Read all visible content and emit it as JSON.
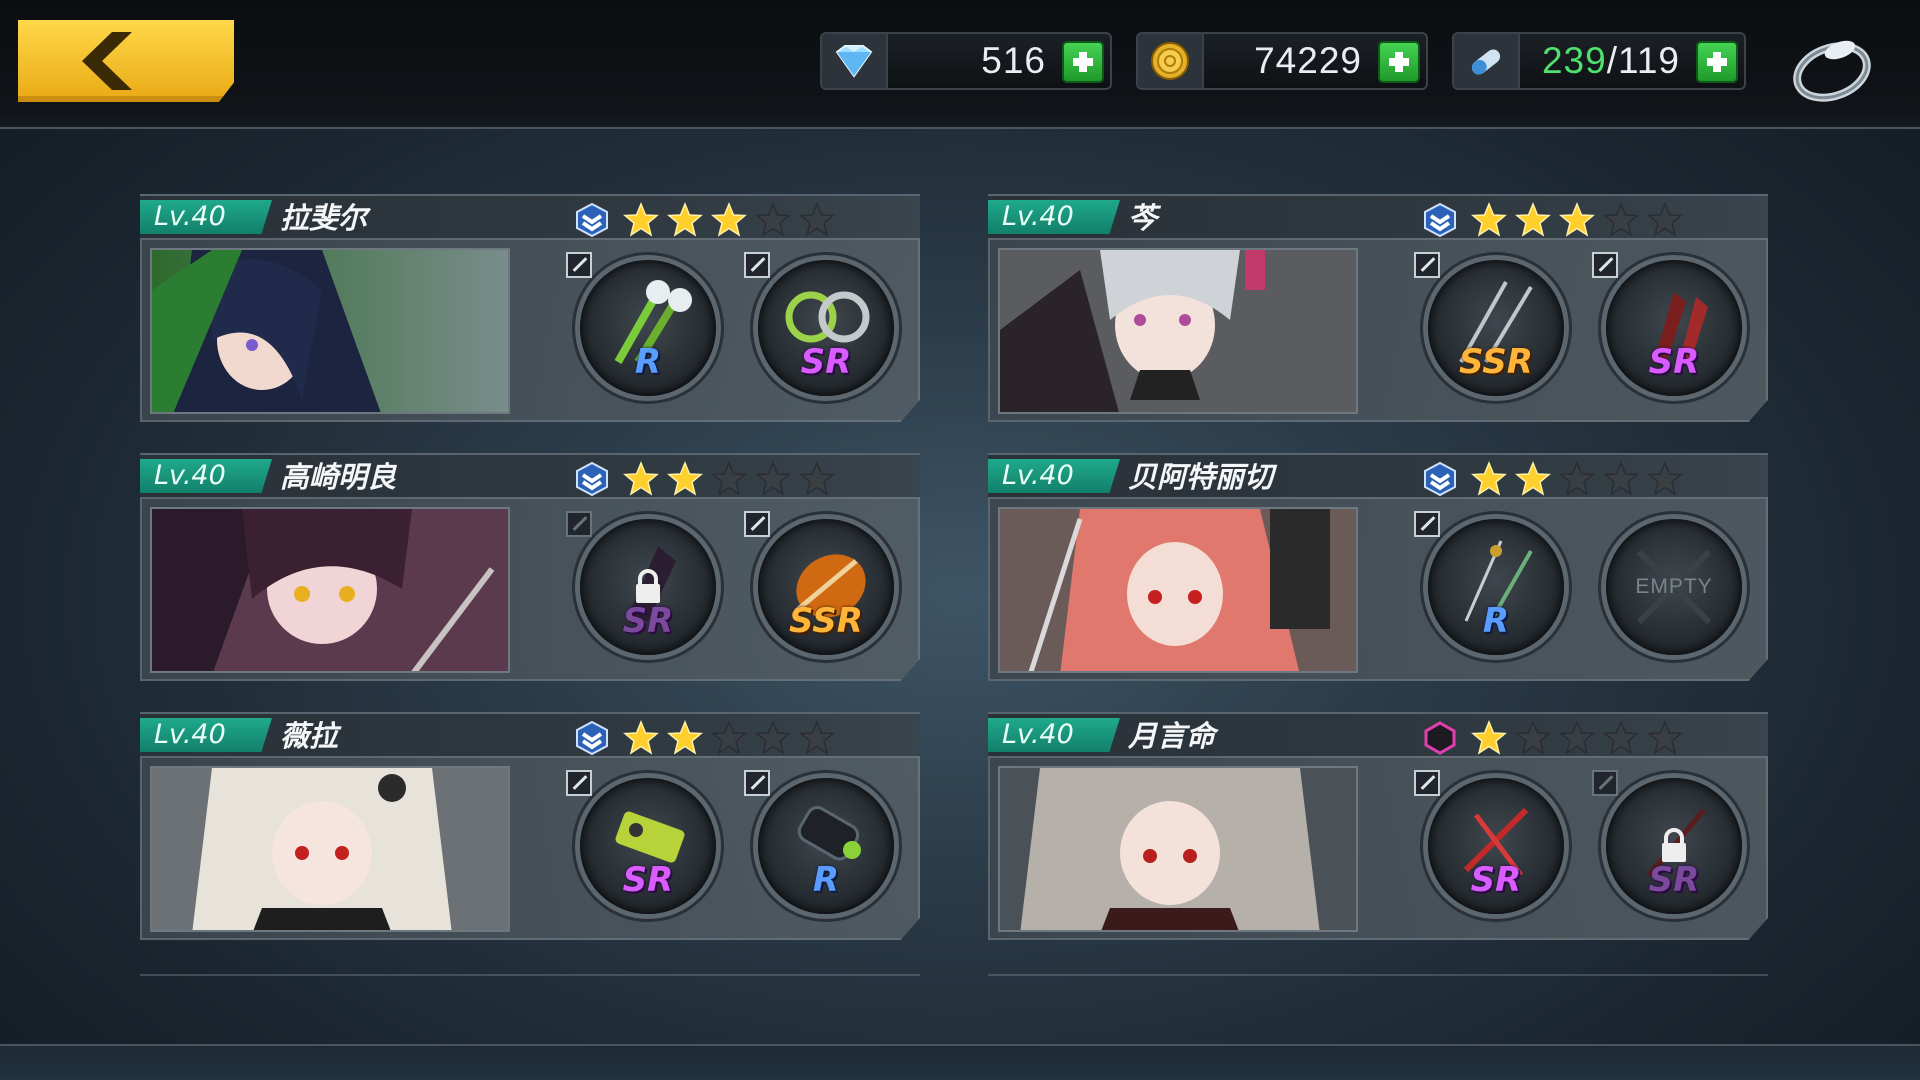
{
  "topbar": {
    "back_button": "back",
    "resources": [
      {
        "id": "gems",
        "icon": "diamond-icon",
        "value": "516"
      },
      {
        "id": "gold",
        "icon": "gold-coin-icon",
        "value": "74229"
      },
      {
        "id": "stamina",
        "icon": "stamina-capsule-icon",
        "current": "239",
        "separator": "/",
        "max": "119"
      }
    ],
    "ring_button_icon": "ring-icon"
  },
  "colors": {
    "level_tag": "#1fa98a",
    "star_active": "#ffcf2e",
    "star_inactive": "#3a3f44",
    "rarity_R": "#5b9cff",
    "rarity_SR": "#d85cff",
    "rarity_SSR": "#ffb43a",
    "resource_plus": "#2fbd3c"
  },
  "characters": [
    {
      "level": "Lv.40",
      "name": "拉斐尔",
      "rank_icon": "blue-chevron-rank-icon",
      "stars": 3,
      "max_stars": 5,
      "portrait": "dark-hair-girl-portrait",
      "slots": [
        {
          "rarity": "R",
          "weapon": "twin-flower-blades",
          "locked": false
        },
        {
          "rarity": "SR",
          "weapon": "thorn-chakrams",
          "locked": false
        }
      ]
    },
    {
      "level": "Lv.40",
      "name": "芩",
      "rank_icon": "blue-chevron-rank-icon",
      "stars": 3,
      "max_stars": 5,
      "portrait": "silver-hair-girl-portrait",
      "slots": [
        {
          "rarity": "SSR",
          "weapon": "twin-katanas",
          "locked": false
        },
        {
          "rarity": "SR",
          "weapon": "crimson-blades",
          "locked": false
        }
      ]
    },
    {
      "level": "Lv.40",
      "name": "高崎明良",
      "rank_icon": "blue-chevron-rank-icon",
      "stars": 2,
      "max_stars": 5,
      "portrait": "guitarist-girl-portrait",
      "slots": [
        {
          "rarity": "SR",
          "weapon": "locked-weapon",
          "locked": true
        },
        {
          "rarity": "SSR",
          "weapon": "electric-guitar",
          "locked": false
        }
      ]
    },
    {
      "level": "Lv.40",
      "name": "贝阿特丽切",
      "rank_icon": "blue-chevron-rank-icon",
      "stars": 2,
      "max_stars": 5,
      "portrait": "pink-hair-knight-portrait",
      "slots": [
        {
          "rarity": "R",
          "weapon": "rapier-pair",
          "locked": false
        },
        {
          "rarity": "",
          "weapon": "empty",
          "label": "EMPTY",
          "locked": false
        }
      ]
    },
    {
      "level": "Lv.40",
      "name": "薇拉",
      "rank_icon": "blue-chevron-rank-icon",
      "stars": 2,
      "max_stars": 5,
      "portrait": "white-hair-girl-portrait",
      "slots": [
        {
          "rarity": "SR",
          "weapon": "death-canister",
          "locked": false
        },
        {
          "rarity": "R",
          "weapon": "cannon",
          "locked": false
        }
      ]
    },
    {
      "level": "Lv.40",
      "name": "月言命",
      "rank_icon": "pink-hexagon-rank-icon",
      "stars": 1,
      "max_stars": 5,
      "portrait": "grey-hair-girl-portrait",
      "slots": [
        {
          "rarity": "SR",
          "weapon": "red-scissors",
          "locked": false
        },
        {
          "rarity": "SR",
          "weapon": "locked-weapon",
          "locked": true
        }
      ]
    }
  ]
}
